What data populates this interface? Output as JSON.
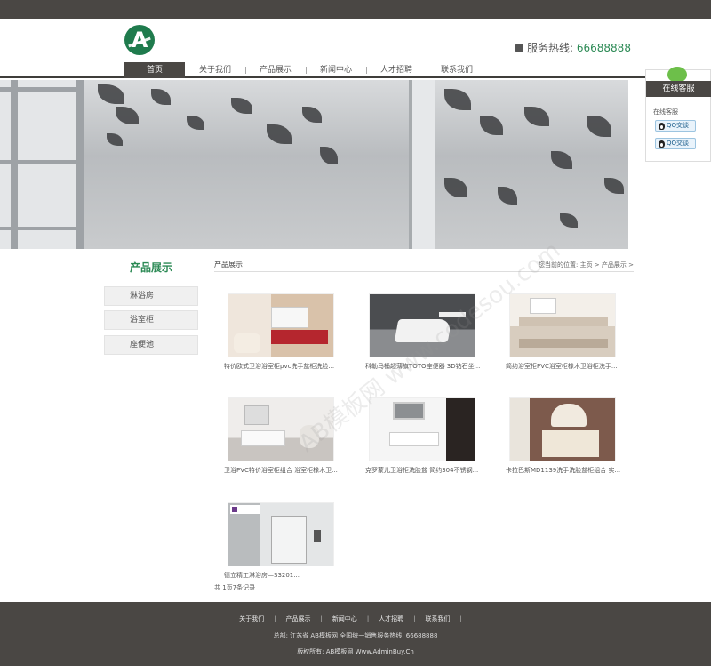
{
  "header": {
    "logo_letter": "A",
    "hotline_label": "服务热线:",
    "hotline_number": "66688888"
  },
  "nav": {
    "items": [
      "首页",
      "关于我们",
      "产品展示",
      "新闻中心",
      "人才招聘",
      "联系我们"
    ],
    "active_index": 0
  },
  "chat_widget": {
    "title": "在线客服",
    "subtitle": "在线客服",
    "buttons": [
      "QQ交谈",
      "QQ交谈"
    ]
  },
  "sidebar": {
    "title": "产品展示",
    "items": [
      "淋浴房",
      "浴室柜",
      "座便池"
    ]
  },
  "content": {
    "section_title": "产品展示",
    "breadcrumb": "您当前的位置: 主页 > 产品展示 >",
    "products": [
      "特价欧式卫浴浴室柜pvc洗手盆柜洗脸...",
      "科勒马桶超薄旗TOTO座便器 3D钻石坐...",
      "简约浴室柜PVC浴室柜橡木卫浴柜洗手...",
      "卫浴PVC特价浴室柜组合 浴室柜橡木卫...",
      "克罗蒙儿卫浴柜洗脸盆 简约304不锈钢...",
      "卡拉巴斯MD1139洗手洗脸盆柜组合 实...",
      "德立精工淋浴房—S3201..."
    ],
    "pager": "共 1页7条记录"
  },
  "footer": {
    "links": [
      "关于我们",
      "产品展示",
      "新闻中心",
      "人才招聘",
      "联系我们"
    ],
    "address": "总部: 江苏省 AB模板网   全国统一销售服务热线: 66688888",
    "copyright": "版权所有: AB模板网 Www.AdminBuy.Cn"
  },
  "watermark": "AB模板网 www.codesou.com",
  "colors": {
    "dark": "#4a4744",
    "accent_green": "#2c8a55"
  }
}
